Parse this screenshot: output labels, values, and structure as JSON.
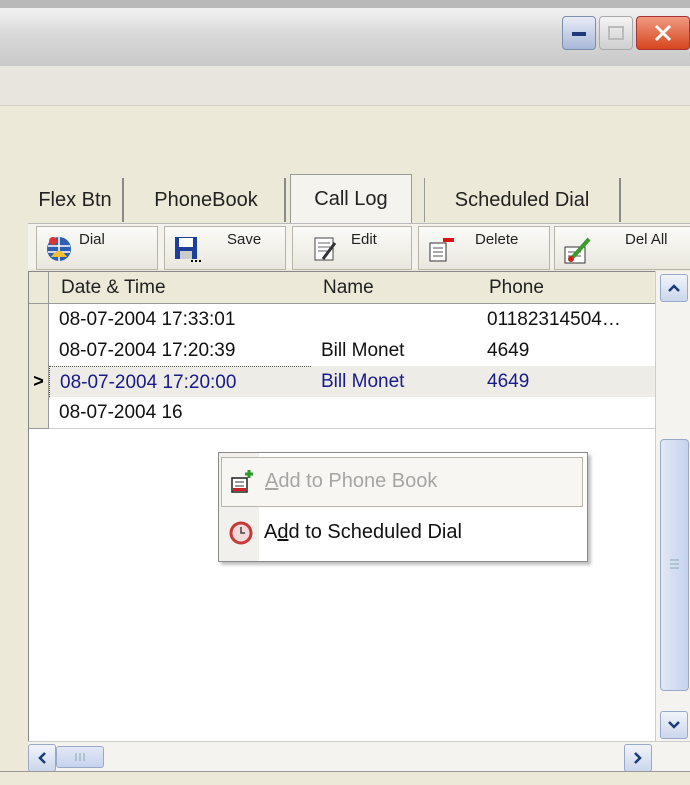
{
  "tabs": [
    {
      "label": "Flex Btn",
      "active": false
    },
    {
      "label": "PhoneBook",
      "active": false
    },
    {
      "label": "Call Log",
      "active": true
    },
    {
      "label": "Scheduled Dial",
      "active": false
    }
  ],
  "toolbar": {
    "dial": "Dial",
    "save": "Save",
    "edit": "Edit",
    "delete": "Delete",
    "del_all": "Del All"
  },
  "grid": {
    "columns": [
      "Date & Time",
      "Name",
      "Phone"
    ],
    "rows": [
      {
        "datetime": "08-07-2004 17:33:01",
        "name": "",
        "phone": "01182314504…"
      },
      {
        "datetime": "08-07-2004 17:20:39",
        "name": "Bill Monet",
        "phone": "4649"
      },
      {
        "datetime": "08-07-2004 17:20:00",
        "name": "Bill Monet",
        "phone": "4649",
        "selected": true
      },
      {
        "datetime": "08-07-2004 16",
        "name": "",
        "phone": ""
      }
    ],
    "row_pointer": ">"
  },
  "context_menu": {
    "items": [
      {
        "access_key": "A",
        "rest": "dd to Phone Book",
        "enabled": false,
        "icon": "add-contact-icon"
      },
      {
        "prefix": "A",
        "access_key": "d",
        "rest": "d to Scheduled Dial",
        "enabled": true,
        "icon": "clock-icon"
      }
    ]
  },
  "colors": {
    "selected_text": "#1a1a8a",
    "close_button": "#d6461d",
    "disabled_text": "#a5a5a5"
  }
}
